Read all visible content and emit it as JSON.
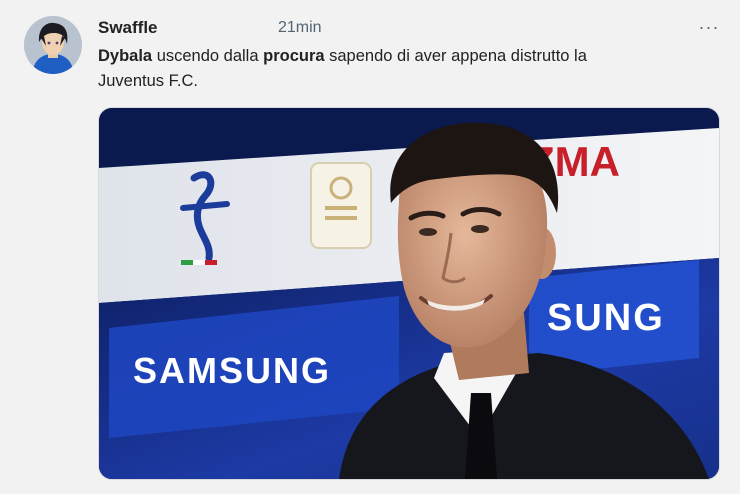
{
  "tweet": {
    "author": "Swaffle",
    "time": "21min",
    "more_label": "···",
    "text_parts": {
      "p1": "Dybala",
      "p2": " uscendo dalla ",
      "p3": "procura",
      "p4": " sapendo di aver appena distrutto la",
      "p5": "Juventus F.C."
    }
  },
  "media": {
    "backdrop_brand_1": "SAMSUNG",
    "backdrop_brand_2": "SUNG",
    "backdrop_brand_3": "ZMA",
    "colors": {
      "backdrop_blue": "#1c3a9e",
      "backdrop_white": "#e9ebef",
      "accent_red": "#c8202a"
    }
  }
}
